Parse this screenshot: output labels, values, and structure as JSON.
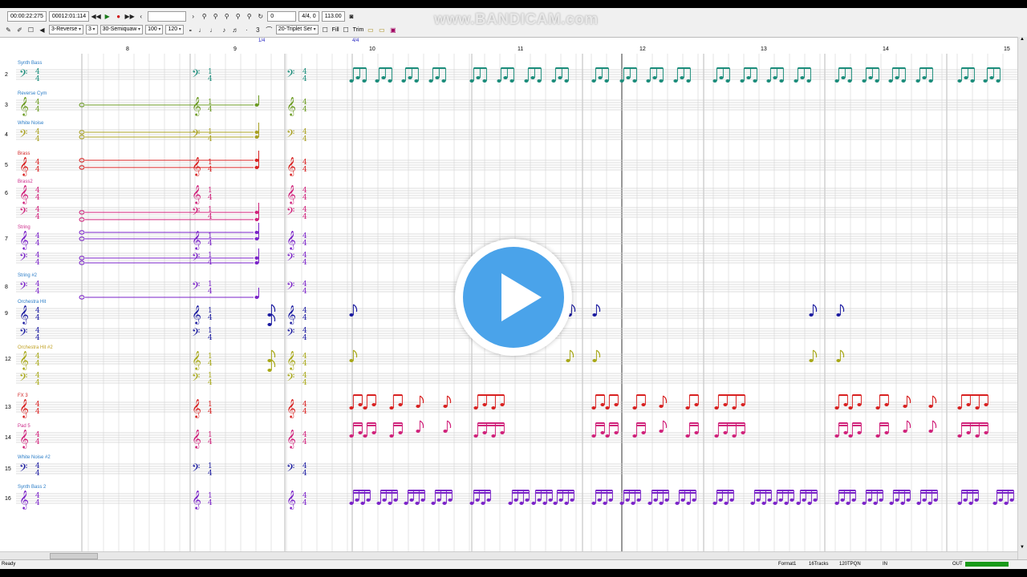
{
  "toolbar": {
    "time_display": "00:00:22:275",
    "position_display": "00012:01:114",
    "track_input": "0",
    "meter_display": "4/4, 0",
    "tempo_display": "113.00"
  },
  "edit_toolbar": {
    "staff_mode": "3-Reverse",
    "voices": "3",
    "note_length": "30-Semiquaw",
    "velocity": "100",
    "gate": "120",
    "triplet": "20-Triplet Ser",
    "fill_label": "Fill",
    "trim_label": "Trim"
  },
  "ruler": {
    "bars": [
      "8",
      "9",
      "10",
      "11",
      "12",
      "13",
      "14",
      "15"
    ],
    "meter_marks": [
      "1/4",
      "4/4"
    ]
  },
  "tracks": [
    {
      "num": "2",
      "name": "Synth Bass",
      "color": "#2a7cc7"
    },
    {
      "num": "3",
      "name": "Reverse Cym",
      "color": "#2a7cc7"
    },
    {
      "num": "4",
      "name": "White Noise",
      "color": "#2a7cc7"
    },
    {
      "num": "5",
      "name": "Brass",
      "color": "#d02020"
    },
    {
      "num": "6",
      "name": "Brass2",
      "color": "#cc2a8a"
    },
    {
      "num": "7",
      "name": "String",
      "color": "#cc2a8a"
    },
    {
      "num": "8",
      "name": "String #2",
      "color": "#2a7cc7"
    },
    {
      "num": "9",
      "name": "Orchestra Hit",
      "color": "#2a7cc7"
    },
    {
      "num": "12",
      "name": "Orchestra Hit #2",
      "color": "#c0a020"
    },
    {
      "num": "13",
      "name": "FX 3",
      "color": "#d02020"
    },
    {
      "num": "14",
      "name": "Pad 5",
      "color": "#cc2a8a"
    },
    {
      "num": "15",
      "name": "White Noise #2",
      "color": "#2a7cc7"
    },
    {
      "num": "16",
      "name": "Synth Bass 2",
      "color": "#2a7cc7"
    }
  ],
  "status": {
    "ready": "Ready",
    "format": "Format1",
    "tracks": "16Tracks",
    "tpqn": "120TPQN",
    "in": "IN",
    "out": "OUT"
  },
  "watermark": "www.BANDICAM.com",
  "colors": {
    "teal": "#1a8c7a",
    "green": "#6a9a20",
    "yellow": "#a8a020",
    "red": "#d82020",
    "magenta": "#d0207a",
    "purple": "#7a22c8",
    "navy": "#1a1aa0",
    "olive": "#a8a818"
  }
}
